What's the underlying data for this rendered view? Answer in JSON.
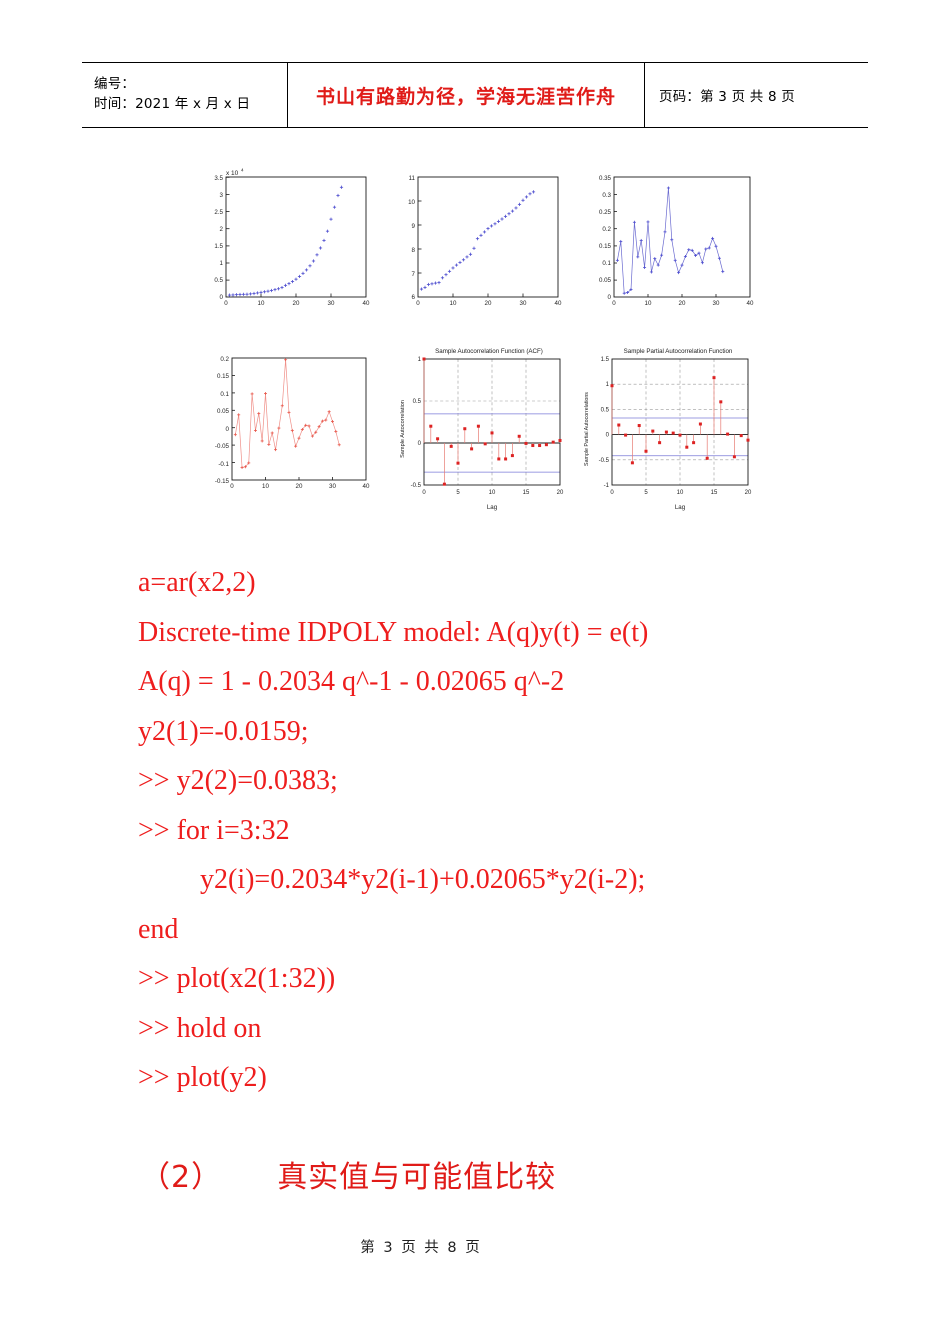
{
  "header": {
    "left": {
      "line1": "编号：",
      "line2": "时间：2021 年 x 月 x 日"
    },
    "motto": "书山有路勤为径，学海无涯苦作舟",
    "right": "页码：第 3 页  共 8 页"
  },
  "code": {
    "lines": [
      {
        "text": "a=ar(x2,2)",
        "indent": false
      },
      {
        "text": "Discrete-time IDPOLY model: A(q)y(t) = e(t)",
        "indent": false
      },
      {
        "text": "A(q) = 1 - 0.2034 q^-1 - 0.02065 q^-2",
        "indent": false
      },
      {
        "text": "y2(1)=-0.0159;",
        "indent": false
      },
      {
        "text": ">> y2(2)=0.0383;",
        "indent": false
      },
      {
        "text": ">> for i=3:32",
        "indent": false
      },
      {
        "text": "y2(i)=0.2034*y2(i-1)+0.02065*y2(i-2);",
        "indent": true
      },
      {
        "text": "end",
        "indent": false
      },
      {
        "text": ">> plot(x2(1:32))",
        "indent": false
      },
      {
        "text": ">> hold on",
        "indent": false
      },
      {
        "text": ">> plot(y2)",
        "indent": false
      }
    ]
  },
  "section": {
    "number": "（2）",
    "title": "真实值与可能值比较"
  },
  "footer": {
    "text": "第 3 页 共 8 页"
  },
  "colors": {
    "red_text": "#ee1d1d",
    "motto_red": "#e01b18",
    "matlab_blue": "#4d4dcf",
    "matlab_red": "#e8564a",
    "stem_red": "#dd2222",
    "bound_blue": "#7b7bd8",
    "axis_black": "#1a1a1a"
  },
  "chart_data": [
    {
      "id": "fig-raw-series",
      "type": "scatter",
      "title": "",
      "exponent_label": "x 10",
      "exponent_sup": "4",
      "xlabel": "",
      "ylabel": "",
      "xlim": [
        0,
        40
      ],
      "ylim": [
        0,
        35000
      ],
      "xticks": [
        0,
        10,
        20,
        30,
        40
      ],
      "yticks": [
        0,
        0.5,
        1,
        1.5,
        2,
        2.5,
        3,
        3.5
      ],
      "ytick_labels": [
        "0",
        "0.5",
        "1",
        "1.5",
        "2",
        "2.5",
        "3",
        "3.5"
      ],
      "grid": false,
      "marker": "+",
      "color": "#4d4dcf",
      "x": [
        1,
        2,
        3,
        4,
        5,
        6,
        7,
        8,
        9,
        10,
        11,
        12,
        13,
        14,
        15,
        16,
        17,
        18,
        19,
        20,
        21,
        22,
        23,
        24,
        25,
        26,
        27,
        28,
        29,
        30,
        31,
        32,
        33
      ],
      "values": [
        560,
        600,
        680,
        740,
        790,
        810,
        900,
        1020,
        1180,
        1350,
        1520,
        1700,
        1900,
        2150,
        2400,
        2750,
        3400,
        3900,
        4500,
        5200,
        6000,
        6900,
        7900,
        9100,
        10500,
        12300,
        14300,
        16500,
        19200,
        22700,
        26200,
        29600,
        32000
      ]
    },
    {
      "id": "fig-log-series",
      "type": "scatter",
      "title": "",
      "xlabel": "",
      "ylabel": "",
      "xlim": [
        0,
        40
      ],
      "ylim": [
        6,
        11
      ],
      "xticks": [
        0,
        10,
        20,
        30,
        40
      ],
      "yticks": [
        6,
        7,
        8,
        9,
        10,
        11
      ],
      "grid": false,
      "marker": "+",
      "color": "#4d4dcf",
      "x": [
        1,
        2,
        3,
        4,
        5,
        6,
        7,
        8,
        9,
        10,
        11,
        12,
        13,
        14,
        15,
        16,
        17,
        18,
        19,
        20,
        21,
        22,
        23,
        24,
        25,
        26,
        27,
        28,
        29,
        30,
        31,
        32,
        33
      ],
      "values": [
        6.33,
        6.4,
        6.52,
        6.55,
        6.58,
        6.6,
        6.8,
        6.93,
        7.07,
        7.21,
        7.33,
        7.44,
        7.55,
        7.67,
        7.78,
        8.03,
        8.43,
        8.57,
        8.71,
        8.85,
        8.96,
        9.05,
        9.15,
        9.25,
        9.36,
        9.47,
        9.58,
        9.71,
        9.86,
        10.03,
        10.17,
        10.3,
        10.38
      ]
    },
    {
      "id": "fig-diff-series-blue",
      "type": "line",
      "title": "",
      "xlabel": "",
      "ylabel": "",
      "xlim": [
        0,
        40
      ],
      "ylim": [
        0,
        0.35
      ],
      "xticks": [
        0,
        10,
        20,
        30,
        40
      ],
      "yticks": [
        0,
        0.05,
        0.1,
        0.15,
        0.2,
        0.25,
        0.3,
        0.35
      ],
      "ytick_labels": [
        "0",
        "0.05",
        "0.1",
        "0.15",
        "0.2",
        "0.25",
        "0.3",
        "0.35"
      ],
      "grid": false,
      "marker": "+",
      "color": "#4d4dcf",
      "x": [
        1,
        2,
        3,
        4,
        5,
        6,
        7,
        8,
        9,
        10,
        11,
        12,
        13,
        14,
        15,
        16,
        17,
        18,
        19,
        20,
        21,
        22,
        23,
        24,
        25,
        26,
        27,
        28,
        29,
        30,
        31,
        32
      ],
      "values": [
        0.107,
        0.162,
        0.011,
        0.013,
        0.022,
        0.218,
        0.117,
        0.165,
        0.086,
        0.219,
        0.073,
        0.112,
        0.093,
        0.122,
        0.19,
        0.318,
        0.167,
        0.107,
        0.071,
        0.093,
        0.118,
        0.138,
        0.136,
        0.121,
        0.128,
        0.1,
        0.14,
        0.143,
        0.171,
        0.148,
        0.113,
        0.074
      ]
    },
    {
      "id": "fig-diff-series-red",
      "type": "line",
      "title": "",
      "xlabel": "",
      "ylabel": "",
      "xlim": [
        0,
        40
      ],
      "ylim": [
        -0.15,
        0.2
      ],
      "xticks": [
        0,
        10,
        20,
        30,
        40
      ],
      "yticks": [
        -0.15,
        -0.1,
        -0.05,
        0,
        0.05,
        0.1,
        0.15,
        0.2
      ],
      "ytick_labels": [
        "-0.15",
        "-0.1",
        "-0.05",
        "0",
        "0.05",
        "0.1",
        "0.15",
        "0.2"
      ],
      "grid": false,
      "marker": "+",
      "color": "#e8564a",
      "x": [
        1,
        2,
        3,
        4,
        5,
        6,
        7,
        8,
        9,
        10,
        11,
        12,
        13,
        14,
        15,
        16,
        17,
        18,
        19,
        20,
        21,
        22,
        23,
        24,
        25,
        26,
        27,
        28,
        29,
        30,
        31,
        32
      ],
      "values": [
        -0.02,
        0.037,
        -0.114,
        -0.112,
        -0.101,
        0.097,
        -0.008,
        0.041,
        -0.038,
        0.098,
        -0.048,
        -0.015,
        -0.063,
        -0.001,
        0.063,
        0.195,
        0.044,
        -0.008,
        -0.053,
        -0.03,
        -0.005,
        0.007,
        0.005,
        -0.024,
        -0.013,
        0.003,
        0.019,
        0.022,
        0.046,
        0.018,
        -0.011,
        -0.049
      ]
    },
    {
      "id": "fig-acf",
      "type": "stem",
      "title": "Sample Autocorrelation Function (ACF)",
      "xlabel": "Lag",
      "ylabel": "Sample Autocorrelation",
      "xlim": [
        0,
        20
      ],
      "ylim": [
        -0.5,
        1
      ],
      "xticks": [
        0,
        5,
        10,
        15,
        20
      ],
      "yticks": [
        -0.5,
        0,
        0.5,
        1
      ],
      "ytick_labels": [
        "-0.5",
        "0",
        "0.5",
        "1"
      ],
      "grid": true,
      "confidence_bounds": [
        0.347,
        -0.347
      ],
      "bound_color": "#7b7bd8",
      "color": "#dd2222",
      "lags": [
        0,
        1,
        2,
        3,
        4,
        5,
        6,
        7,
        8,
        9,
        10,
        11,
        12,
        13,
        14,
        15,
        16,
        17,
        18,
        19,
        20
      ],
      "values": [
        1.0,
        0.2,
        0.05,
        -0.49,
        -0.04,
        -0.24,
        0.17,
        -0.07,
        0.2,
        -0.01,
        0.12,
        -0.19,
        -0.19,
        -0.15,
        0.08,
        -0.005,
        -0.03,
        -0.03,
        -0.02,
        0.01,
        0.03
      ]
    },
    {
      "id": "fig-pacf",
      "type": "stem",
      "title": "Sample Partial Autocorrelation Function",
      "xlabel": "Lag",
      "ylabel": "Sample Partial Autocorrelations",
      "xlim": [
        0,
        20
      ],
      "ylim": [
        -1,
        1.5
      ],
      "xticks": [
        0,
        5,
        10,
        15,
        20
      ],
      "yticks": [
        -1,
        -0.5,
        0,
        0.5,
        1,
        1.5
      ],
      "ytick_labels": [
        "-1",
        "-0.5",
        "0",
        "0.5",
        "1",
        "1.5"
      ],
      "grid": true,
      "confidence_bounds": [
        0.33,
        -0.42
      ],
      "bound_color": "#7b7bd8",
      "color": "#dd2222",
      "lags": [
        0,
        1,
        2,
        3,
        4,
        5,
        6,
        7,
        8,
        9,
        10,
        11,
        12,
        13,
        14,
        15,
        16,
        17,
        18,
        19,
        20
      ],
      "values": [
        0.97,
        0.19,
        -0.01,
        -0.56,
        0.18,
        -0.33,
        0.07,
        -0.16,
        0.05,
        0.03,
        -0.01,
        -0.25,
        -0.16,
        0.21,
        -0.47,
        1.13,
        0.65,
        0.01,
        -0.44,
        -0.02,
        -0.11
      ]
    }
  ]
}
